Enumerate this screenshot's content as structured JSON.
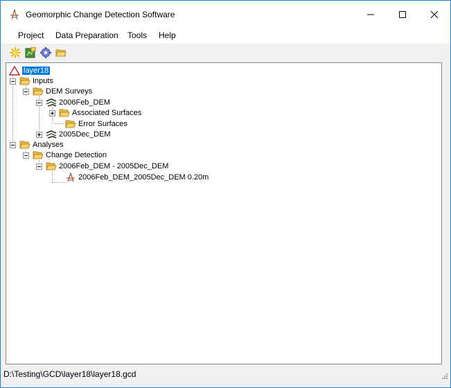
{
  "window": {
    "title": "Geomorphic Change Detection Software"
  },
  "menu": [
    "Project",
    "Data Preparation",
    "Tools",
    "Help"
  ],
  "toolbar": {
    "icons": [
      "new-project-icon",
      "add-dem-icon",
      "settings-gear-icon",
      "open-folder-icon"
    ]
  },
  "tree": {
    "root": "layer18",
    "inputs": "Inputs",
    "dem_surveys": "DEM Surveys",
    "dem1": "2006Feb_DEM",
    "associated_surfaces": "Associated Surfaces",
    "error_surfaces": "Error Surfaces",
    "dem2": "2005Dec_DEM",
    "analyses": "Analyses",
    "change_detection": "Change Detection",
    "change_pair": "2006Feb_DEM - 2005Dec_DEM",
    "change_result": "2006Feb_DEM_2005Dec_DEM 0.20m"
  },
  "status": {
    "path": "D:\\Testing\\GCD\\layer18\\layer18.gcd"
  },
  "colors": {
    "folder": "#f7d46a",
    "selection": "#0078d7",
    "border": "#1883d7"
  }
}
